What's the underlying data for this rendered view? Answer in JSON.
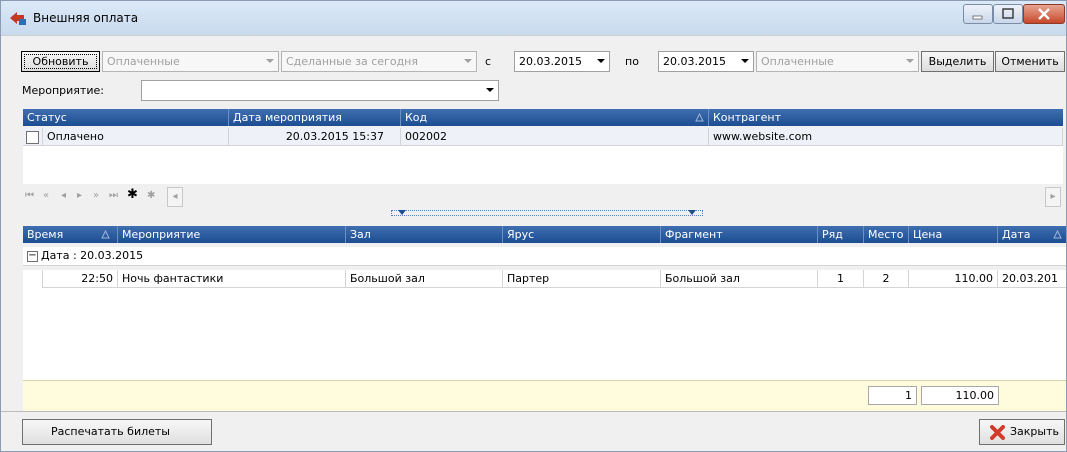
{
  "window": {
    "title": "Внешняя оплата"
  },
  "toolbar": {
    "refresh_label": "Обновить",
    "status_filter_1": "Оплаченные",
    "date_filter": "Сделанные за сегодня",
    "from_label": "с",
    "date_from": "20.03.2015",
    "to_label": "по",
    "date_to": "20.03.2015",
    "status_filter_2": "Оплаченные",
    "select_label": "Выделить",
    "cancel_label": "Отменить"
  },
  "event_filter": {
    "label": "Мероприятие:",
    "value": ""
  },
  "orders_grid": {
    "columns": [
      "Статус",
      "Дата мероприятия",
      "Код",
      "Контрагент"
    ],
    "rows": [
      {
        "status": "Оплачено",
        "event_date": "20.03.2015 15:37",
        "code": "002002",
        "counterparty": "www.website.com"
      }
    ]
  },
  "navigator": {
    "icons": [
      "first-icon",
      "prev-page-icon",
      "prev-icon",
      "next-icon",
      "next-page-icon",
      "last-icon",
      "insert-icon",
      "append-icon"
    ]
  },
  "tickets_grid": {
    "columns": [
      "Время",
      "Мероприятие",
      "Зал",
      "Ярус",
      "Фрагмент",
      "Ряд",
      "Место",
      "Цена",
      "Дата"
    ],
    "group_label": "Дата : 20.03.2015",
    "rows": [
      {
        "time": "22:50",
        "event": "Ночь фантастики",
        "hall": "Большой зал",
        "tier": "Партер",
        "fragment": "Большой зал",
        "row": "1",
        "seat": "2",
        "price": "110.00",
        "date": "20.03.201"
      }
    ],
    "footer": {
      "count": "1",
      "total": "110.00"
    }
  },
  "bottom": {
    "print_label": "Распечатать билеты",
    "close_label": "Закрыть"
  }
}
